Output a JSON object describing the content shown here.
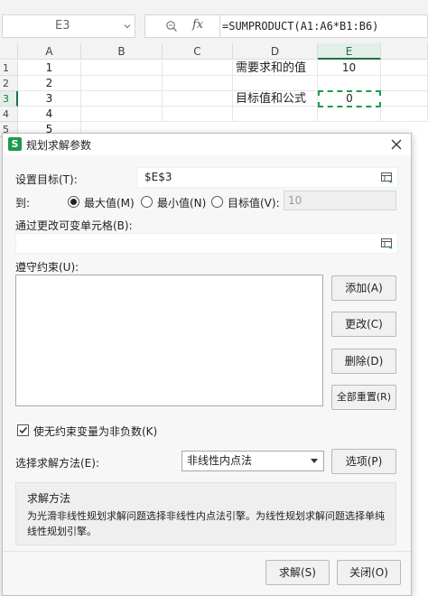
{
  "formula_bar": {
    "name_box": "E3",
    "fx_label": "fx",
    "formula": "=SUMPRODUCT(A1:A6*B1:B6)"
  },
  "sheet": {
    "columns": [
      "A",
      "B",
      "C",
      "D",
      "E"
    ],
    "rows": [
      "1",
      "2",
      "3",
      "4",
      "5"
    ],
    "cells": {
      "A1": "1",
      "A2": "2",
      "A3": "3",
      "A4": "4",
      "A5": "5",
      "D1": "需要求和的值",
      "E1": "10",
      "D3": "目标值和公式",
      "E3": "0"
    }
  },
  "dialog": {
    "icon_letter": "S",
    "title": "规划求解参数",
    "set_objective_label": "设置目标(T):",
    "set_objective_value": "$E$3",
    "to_label": "到:",
    "radio_max": "最大值(M)",
    "radio_min": "最小值(N)",
    "radio_target": "目标值(V):",
    "target_value": "10",
    "changing_cells_label": "通过更改可变单元格(B):",
    "changing_cells_value": "",
    "constraints_label": "遵守约束(U):",
    "btn_add": "添加(A)",
    "btn_change": "更改(C)",
    "btn_delete": "删除(D)",
    "btn_reset_all": "全部重置(R)",
    "nonneg_label": "使无约束变量为非负数(K)",
    "method_label": "选择求解方法(E):",
    "method_value": "非线性内点法",
    "btn_options": "选项(P)",
    "desc_title": "求解方法",
    "desc_text": "为光滑非线性规划求解问题选择非线性内点法引擎。为线性规划求解问题选择单纯线性规划引擎。",
    "btn_solve": "求解(S)",
    "btn_close": "关闭(O)"
  },
  "colors": {
    "accent_green": "#1e9a4c",
    "dialog_bg": "#f7f7f7"
  }
}
